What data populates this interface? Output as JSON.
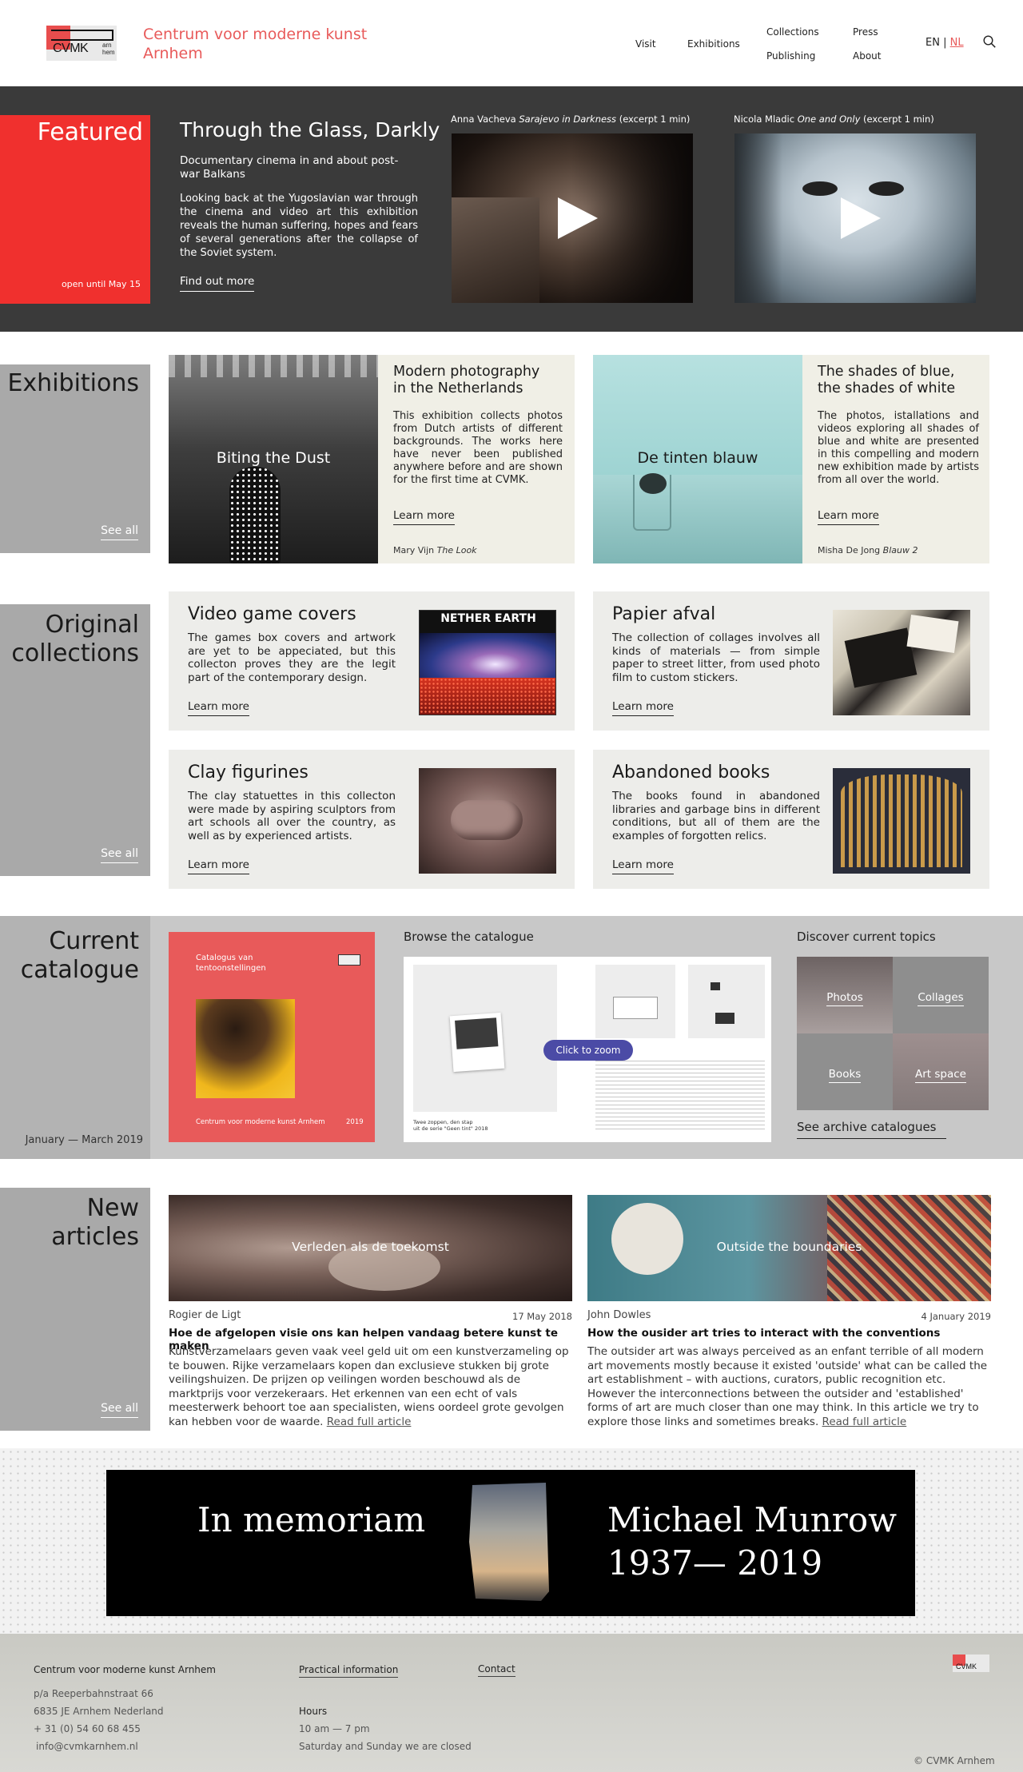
{
  "header": {
    "logo_text": "CVMK",
    "logo_sub": "arn hem",
    "brand_line1": "Centrum voor moderne kunst",
    "brand_line2": "Arnhem",
    "nav": {
      "visit": "Visit",
      "exhibitions": "Exhibitions",
      "collections": "Collections",
      "publishing": "Publishing",
      "press": "Press",
      "about": "About"
    },
    "lang_en": "EN",
    "lang_sep": "|",
    "lang_nl": "NL",
    "search_icon": "search-icon"
  },
  "featured": {
    "label": "Featured",
    "date": "open until May 15",
    "title": "Through the Glass, Darkly",
    "subtitle": "Documentary cinema in and about post-war Balkans",
    "text": "Looking back at the Yugoslavian war through the cinema and video art this exhibition reveals the human suffering, hopes and fears of several generations after the collapse of the Soviet system.",
    "link": "Find out more",
    "videos": [
      {
        "artist": "Anna Vacheva ",
        "work": "Sarajevo in Darkness",
        "note": " (excerpt 1 min)"
      },
      {
        "artist": "Nicola Mladic ",
        "work": "One and Only",
        "note": " (excerpt 1 min)"
      }
    ]
  },
  "exhibitions": {
    "label": "Exhibitions",
    "see_all": "See all",
    "cards": [
      {
        "image_label": "Biting the Dust",
        "title_line1": "Modern photography",
        "title_line2": "in the Netherlands",
        "text": "This exhibition collects photos from Dutch artists of different backgrounds. The works here have never been published anywhere before and are shown for the first time at CVMK.",
        "link": "Learn more",
        "credit_artist": "Mary Vijn ",
        "credit_work": "The Look"
      },
      {
        "image_label": "De tinten blauw",
        "title_line1": "The shades of blue,",
        "title_line2": "the shades of white",
        "text": "The photos, istallations and videos exploring all shades of blue and white are presented in this compelling and modern new exhibition made by artists from all over the world.",
        "link": "Learn more",
        "credit_artist": "Misha De Jong ",
        "credit_work": "Blauw 2"
      }
    ]
  },
  "collections": {
    "label_line1": "Original",
    "label_line2": "collections",
    "see_all": "See all",
    "cards": [
      {
        "title": "Video game covers",
        "text": "The games box covers and artwork are yet to be appeciated, but this collecton proves they are the legit part of the contemporary design.",
        "link": "Learn more",
        "image_text": "NETHER EARTH"
      },
      {
        "title": "Papier afval",
        "text": "The collection of collages involves all kinds of materials — from simple paper to street litter, from used photo film to custom stickers.",
        "link": "Learn more"
      },
      {
        "title": "Clay figurines",
        "text": "The clay statuettes in this collecton were made by aspiring sculptors from art schools all over the country, as well as by experienced artists.",
        "link": "Learn more"
      },
      {
        "title": "Abandoned books",
        "text": "The books found in abandoned libraries and garbage bins in different conditions, but all of them are the examples of forgotten relics.",
        "link": "Learn more"
      }
    ]
  },
  "catalogue": {
    "label_line1": "Current",
    "label_line2": "catalogue",
    "period": "January — March 2019",
    "cover_title_line1": "Catalogus van",
    "cover_title_line2": "tentoonstellingen",
    "cover_footer": "Centrum voor moderne kunst Arnhem",
    "cover_year": "2019",
    "browse_label": "Browse the catalogue",
    "zoom_label": "Click to zoom",
    "book_caption_line1": "Twee zoppen, den stap",
    "book_caption_line2": "uit de serie \"Geen tint\" 2018",
    "topics_label": "Discover current topics",
    "topics": [
      "Photos",
      "Collages",
      "Books",
      "Art space"
    ],
    "archive_link": "See archive catalogues"
  },
  "articles": {
    "label_line1": "New",
    "label_line2": "articles",
    "see_all": "See all",
    "items": [
      {
        "image_label": "Verleden als de toekomst",
        "author": "Rogier de Ligt",
        "date": "17 May 2018",
        "title": "Hoe de afgelopen visie ons kan helpen vandaag betere kunst te maken",
        "text": "Kunstverzamelaars geven vaak veel geld uit om een kunstverzameling op te bouwen. Rijke verzamelaars kopen dan exclusieve stukken bij grote veilingshuizen. De prijzen op veilingen worden beschouwd als de marktprijs voor verzekeraars. Het erkennen van een echt of vals meesterwerk behoort toe aan specialisten, wiens oordeel grote gevolgen kan hebben voor de waarde.",
        "read": "Read full article"
      },
      {
        "image_label": "Outside the boundaries",
        "author": "John Dowles",
        "date": "4 January 2019",
        "title": "How the ousider art tries to interact with the conventions",
        "text": "The outsider art was always perceived as an enfant terrible of all modern art movements mostly because it existed 'outside' what can be called the art establishment – with auctions, curators, public recognition etc. However the interconnections between the outsider and 'established' forms of art are much closer than one may think. In this article we try to explore those links and sometimes breaks.",
        "read": "Read full article"
      }
    ]
  },
  "memoriam": {
    "left": "In memoriam",
    "name": "Michael Munrow",
    "years": "1937— 2019"
  },
  "footer": {
    "org": "Centrum voor moderne kunst Arnhem",
    "address1": "p/a Reeperbahnstraat 66",
    "address2": "6835 JE Arnhem Nederland",
    "phone": "+ 31 (0) 54 60 68 455",
    "email": "info@cvmkarnhem.nl",
    "practical": "Practical information",
    "contact": "Contact",
    "hours_label": "Hours",
    "hours": "10 am — 7 pm",
    "closed": "Saturday and Sunday we are closed",
    "copyright": "© CVMK Arnhem",
    "logo_text": "CVMK"
  },
  "colors": {
    "accent": "#f0302e",
    "brand_text": "#e85a5a",
    "dark_band": "#3a3a3a",
    "label_grey": "#a9a9a9",
    "card_beige": "#f0efe6",
    "zoom_button": "#4b4ba6"
  }
}
